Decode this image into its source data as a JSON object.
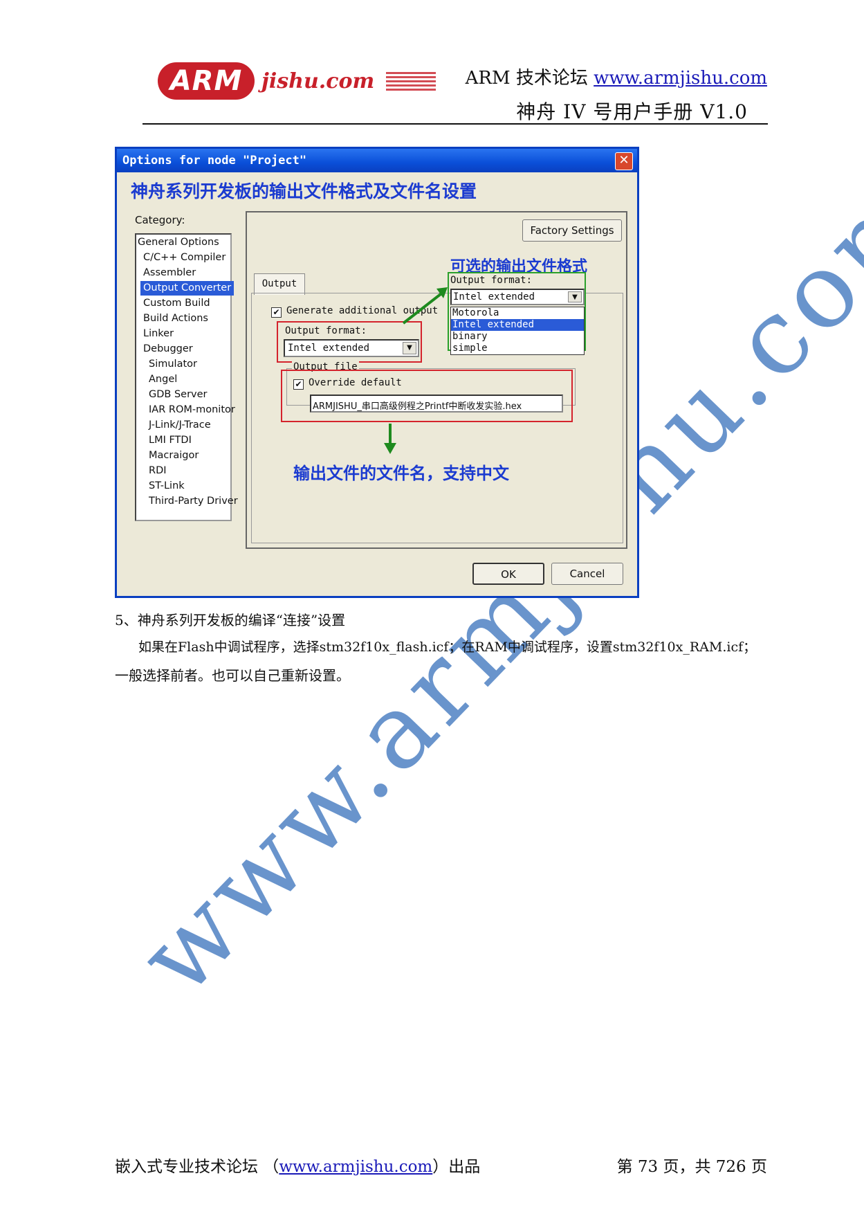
{
  "header": {
    "logo_text": "ARM",
    "logo_suffix": "jishu.com",
    "line1_prefix": "ARM 技术论坛",
    "line1_link": "www.armjishu.com",
    "line2": "神舟 IV 号用户手册  V1.0"
  },
  "dialog": {
    "title": "Options for node \"Project\"",
    "close_glyph": "✕",
    "banner": "神舟系列开发板的输出文件格式及文件名设置",
    "category_label": "Category:",
    "categories": [
      "General Options",
      "C/C++ Compiler",
      "Assembler",
      "Output Converter",
      "Custom Build",
      "Build Actions",
      "Linker",
      "Debugger",
      "Simulator",
      "Angel",
      "GDB Server",
      "IAR ROM-monitor",
      "J-Link/J-Trace",
      "LMI FTDI",
      "Macraigor",
      "RDI",
      "ST-Link",
      "Third-Party Driver"
    ],
    "selected_category": "Output Converter",
    "factory_settings": "Factory Settings",
    "tab_label": "Output",
    "generate_label": "Generate additional output",
    "output_format_label": "Output format:",
    "output_format_value": "Intel extended",
    "output_file_group": "Output file",
    "override_label": "Override default",
    "filename": "ARMJISHU_串口高级例程之Printf中断收发实验.hex",
    "note_formats": "可选的输出文件格式",
    "note_filename": "输出文件的文件名，支持中文",
    "dropdown": {
      "label": "Output format:",
      "value": "Intel extended",
      "options": [
        "Motorola",
        "Intel extended",
        "binary",
        "simple"
      ],
      "selected": "Intel extended"
    },
    "ok": "OK",
    "cancel": "Cancel",
    "arrow_icon": "▼",
    "check_icon": "✔"
  },
  "body": {
    "section_heading": "5、神舟系列开发板的编译“连接”设置",
    "paragraph_line1": "如果在Flash中调试程序，选择stm32f10x_flash.icf；在RAM中调试程序，设置stm32f10x_RAM.icf；",
    "paragraph_line2": "一般选择前者。也可以自己重新设置。"
  },
  "watermark": "www.armjishu.com",
  "footer": {
    "left_prefix": "嵌入式专业技术论坛  （",
    "left_link": "www.armjishu.com",
    "left_suffix": "）出品",
    "right": "第 73 页，共 726 页"
  },
  "colors": {
    "accent_blue": "#1b3bd0",
    "logo_red": "#c8202a",
    "highlight_red": "#d4232c",
    "highlight_green": "#2aa02a",
    "watermark_blue": "#4f82c4"
  }
}
